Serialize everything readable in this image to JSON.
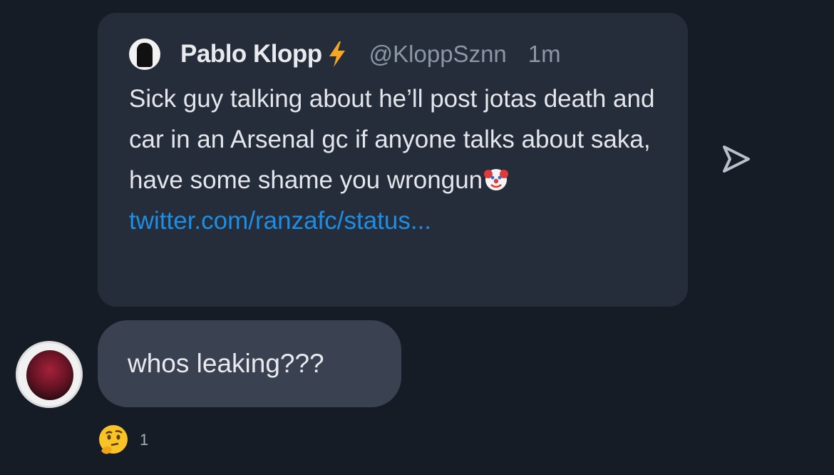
{
  "tweet": {
    "author_name": "Pablo Klopp",
    "handle": "@KloppSznn",
    "time": "1m",
    "body_text": "Sick guy talking about he’ll post jotas death and car in an Arsenal gc if anyone talks about saka, have some shame you wrongun",
    "link_text": " twitter.com/ranzafc/status...",
    "emoji": "clown-face",
    "badge_icon": "lightning-bolt-icon"
  },
  "message": {
    "text": "whos leaking???"
  },
  "reaction": {
    "emoji": "thinking-face",
    "count": "1"
  },
  "colors": {
    "background": "#161c26",
    "card": "#262d3a",
    "bubble": "#3a4252",
    "link": "#1d8ee6",
    "bolt": "#f5a623"
  },
  "icons": {
    "share": "send-arrow-icon"
  }
}
